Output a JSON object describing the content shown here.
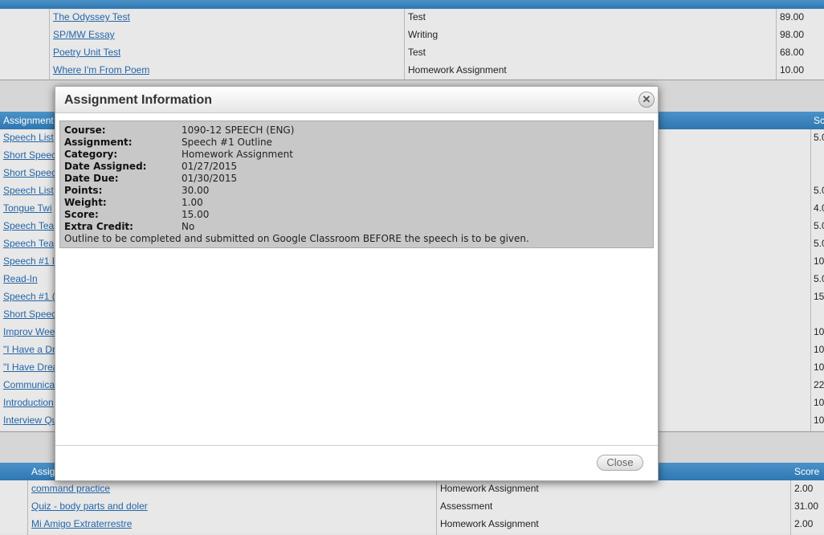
{
  "top_table": {
    "rows": [
      {
        "name": "The Odyssey Test",
        "category": "Test",
        "score": "89.00"
      },
      {
        "name": "SP/MW Essay",
        "category": "Writing",
        "score": "98.00"
      },
      {
        "name": "Poetry Unit Test",
        "category": "Test",
        "score": "68.00"
      },
      {
        "name": "Where I'm From Poem",
        "category": "Homework Assignment",
        "score": "10.00"
      }
    ]
  },
  "middle_table": {
    "header_assignment": "Assignment",
    "header_score": "Sc",
    "rows": [
      {
        "name": "Speech List",
        "score": "5.0"
      },
      {
        "name": "Short Speec",
        "score": ""
      },
      {
        "name": "Short Speec",
        "score": ""
      },
      {
        "name": "Speech List",
        "score": "5.0"
      },
      {
        "name": "Tongue Twi",
        "score": "4.0"
      },
      {
        "name": "Speech Tea",
        "score": "5.0"
      },
      {
        "name": "Speech Tea",
        "score": "5.0"
      },
      {
        "name": "Speech #1 I",
        "score": "10"
      },
      {
        "name": "Read-In",
        "score": "5.0"
      },
      {
        "name": "Speech #1 (",
        "score": "15"
      },
      {
        "name": "Short Speec",
        "score": ""
      },
      {
        "name": "Improv Wee",
        "score": "10"
      },
      {
        "name": "\"I Have a Dr",
        "score": "10"
      },
      {
        "name": "\"I Have Drea",
        "score": "10"
      },
      {
        "name": "Communica",
        "score": "22"
      },
      {
        "name": "Introduction",
        "score": "10"
      },
      {
        "name": "Interview Qu",
        "score": "10"
      }
    ]
  },
  "bottom_table": {
    "header_assignment": "Assig",
    "header_score": "Score",
    "rows": [
      {
        "name": "command practice",
        "category": "Homework Assignment",
        "score": "2.00"
      },
      {
        "name": "Quiz - body parts and doler",
        "category": "Assessment",
        "score": "31.00"
      },
      {
        "name": "Mi Amigo Extraterrestre",
        "category": "Homework Assignment",
        "score": "2.00"
      }
    ]
  },
  "modal": {
    "title": "Assignment Information",
    "close_label": "Close",
    "fields": [
      {
        "label": "Course:",
        "value": "1090-12 SPEECH (ENG)"
      },
      {
        "label": "Assignment:",
        "value": "Speech #1 Outline"
      },
      {
        "label": "Category:",
        "value": "Homework Assignment"
      },
      {
        "label": "Date Assigned:",
        "value": "01/27/2015"
      },
      {
        "label": "Date Due:",
        "value": "01/30/2015"
      },
      {
        "label": "Points:",
        "value": "30.00"
      },
      {
        "label": "Weight:",
        "value": "1.00"
      },
      {
        "label": "Score:",
        "value": "15.00"
      },
      {
        "label": "Extra Credit:",
        "value": "No"
      }
    ],
    "description": "Outline to be completed and submitted on Google Classroom BEFORE the speech is to be given."
  }
}
